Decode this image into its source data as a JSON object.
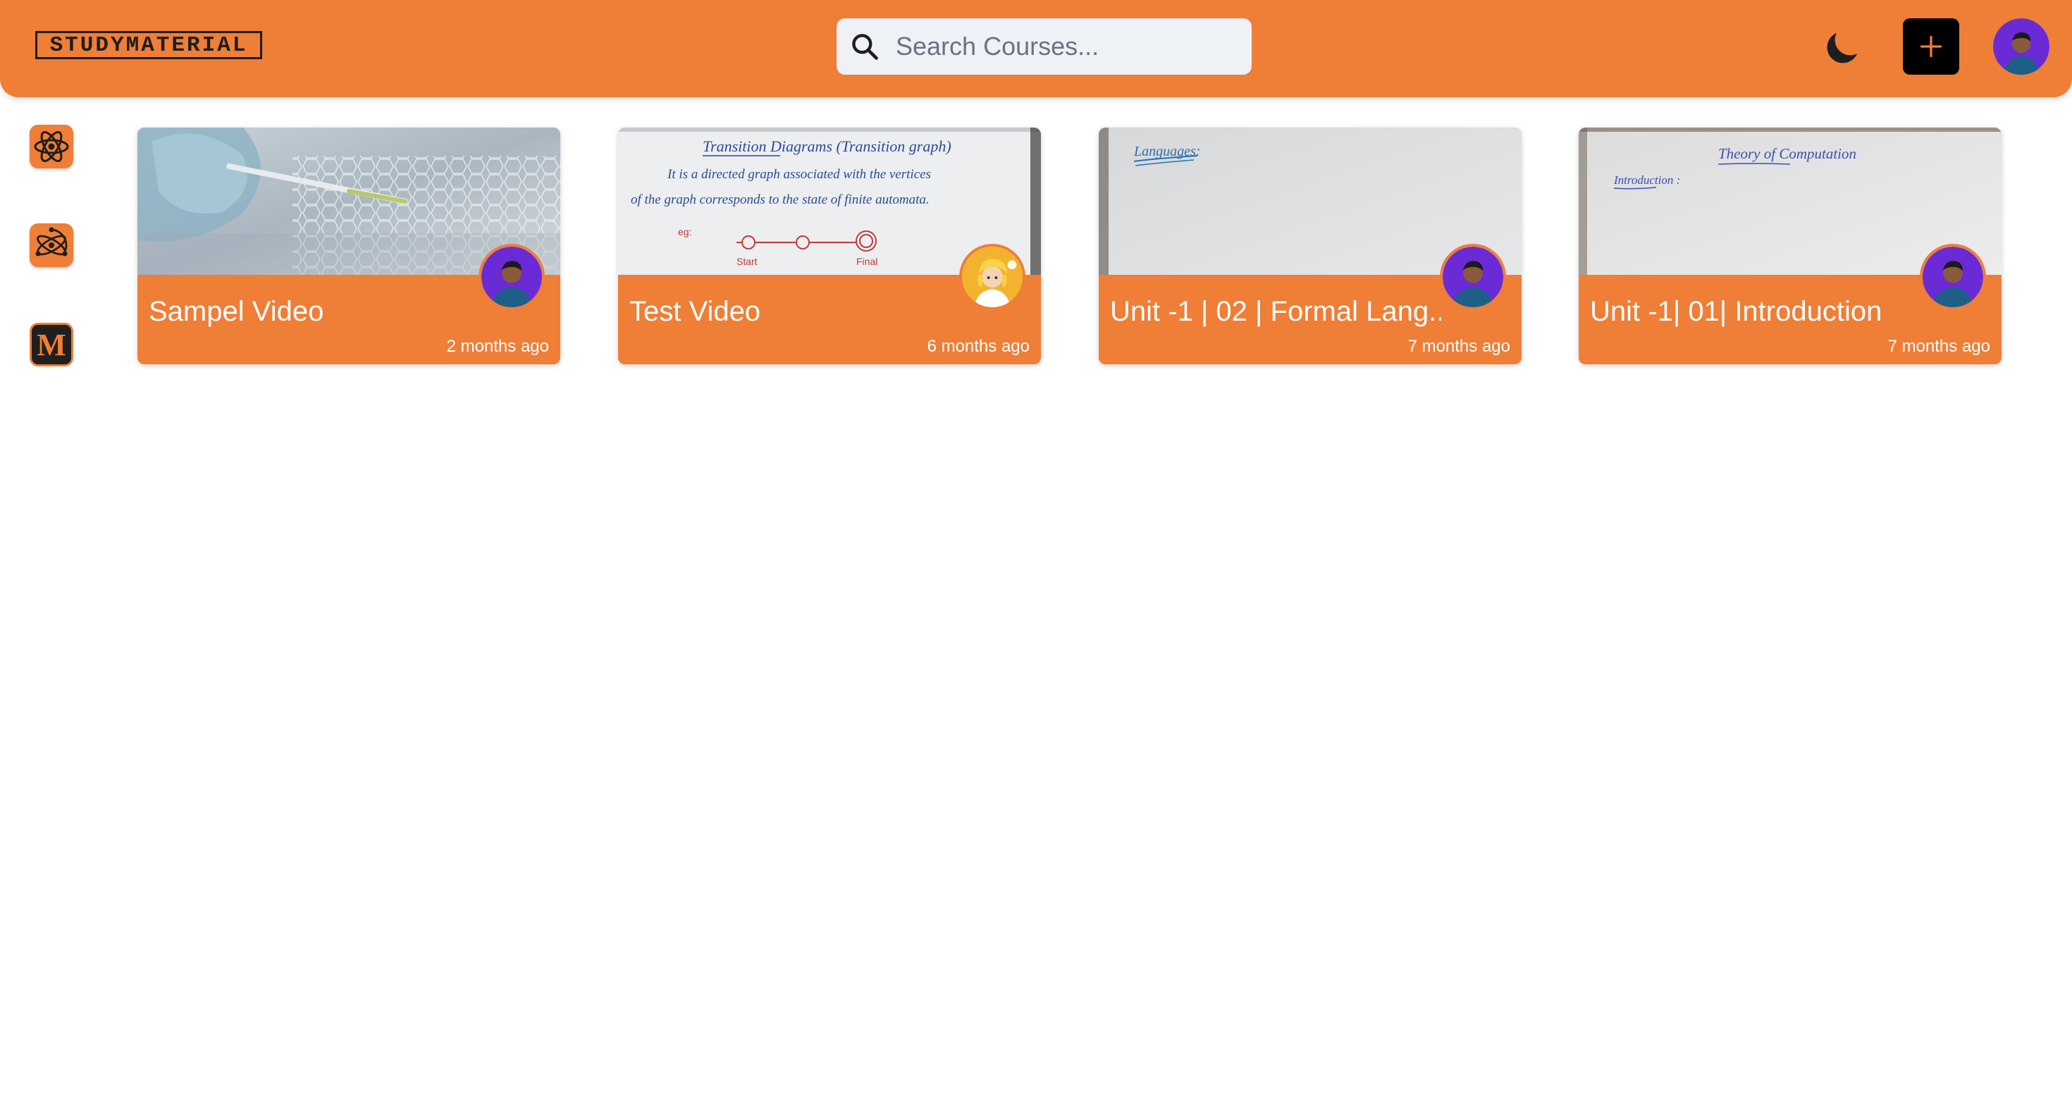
{
  "app": {
    "logo_text": "STUDYMATERIAL",
    "accent_color": "#ef7e37"
  },
  "header": {
    "search": {
      "placeholder": "Search Courses...",
      "value": ""
    },
    "theme_toggle_icon": "moon-icon",
    "add_icon": "plus-icon",
    "profile_icon": "user-avatar"
  },
  "sidebar": {
    "items": [
      {
        "icon": "react-atom-icon"
      },
      {
        "icon": "electron-atom-icon"
      },
      {
        "icon": "medium-m-icon",
        "label": "M"
      }
    ]
  },
  "cards": [
    {
      "title": "Sampel Video",
      "time": "2 months ago"
    },
    {
      "title": "Test Video",
      "time": "6 months ago"
    },
    {
      "title": "Unit -1 | 02 | Formal Lang...",
      "time": "7 months ago"
    },
    {
      "title": "Unit -1| 01| Introduction",
      "time": "7 months ago"
    }
  ],
  "thumbnails": {
    "card2": {
      "heading": "Transition Diagrams (Transition graph)",
      "line1": "It is a directed graph associated with the vertices",
      "line2": "of the graph corresponds to the state of finite automata.",
      "eg": "eg:",
      "start": "Start",
      "final": "Final"
    },
    "card3": {
      "heading": "Languages:"
    },
    "card4": {
      "heading": "Theory of Computation",
      "sub": "Introduction :"
    }
  }
}
